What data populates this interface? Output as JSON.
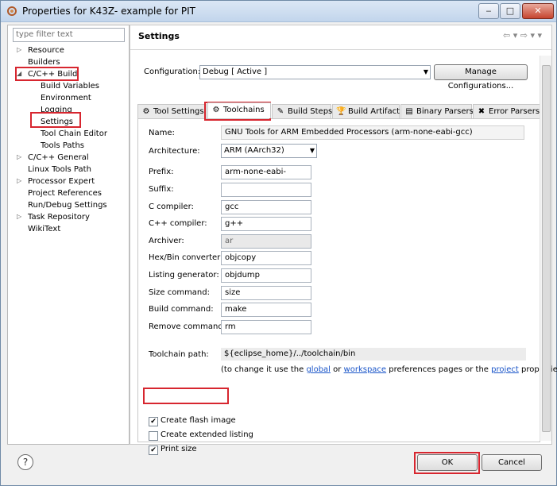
{
  "window": {
    "title": "Properties for K43Z- example for PIT",
    "controls": {
      "minimize": "‒",
      "maximize": "□",
      "close": "✕"
    }
  },
  "left": {
    "filter_placeholder": "type filter text",
    "tree": [
      {
        "label": "Resource",
        "expander": "▷"
      },
      {
        "label": "Builders"
      },
      {
        "label": "C/C++ Build",
        "expander": "◢"
      },
      {
        "label": "Build Variables"
      },
      {
        "label": "Environment"
      },
      {
        "label": "Logging"
      },
      {
        "label": "Settings"
      },
      {
        "label": "Tool Chain Editor"
      },
      {
        "label": "Tools Paths"
      },
      {
        "label": "C/C++ General",
        "expander": "▷"
      },
      {
        "label": "Linux Tools Path"
      },
      {
        "label": "Processor Expert",
        "expander": "▷"
      },
      {
        "label": "Project References"
      },
      {
        "label": "Run/Debug Settings"
      },
      {
        "label": "Task Repository",
        "expander": "▷"
      },
      {
        "label": "WikiText"
      }
    ]
  },
  "right": {
    "title": "Settings",
    "nav": "⇦ ▾ ⇨ ▾ ▾",
    "configuration_label": "Configuration:",
    "configuration_value": "Debug  [ Active ]",
    "manage_button": "Manage Configurations...",
    "tabs": [
      {
        "label": "Tool Settings",
        "icon": "⚙",
        "icon_name": "tool-settings-icon"
      },
      {
        "label": "Toolchains",
        "icon": "⚙",
        "icon_name": "toolchains-icon"
      },
      {
        "label": "Build Steps",
        "icon": "✎",
        "icon_name": "build-steps-icon"
      },
      {
        "label": "Build Artifact",
        "icon": "🏆",
        "icon_name": "build-artifact-icon"
      },
      {
        "label": "Binary Parsers",
        "icon": "▤",
        "icon_name": "binary-parsers-icon"
      },
      {
        "label": "Error Parsers",
        "icon": "✖",
        "icon_name": "error-parsers-icon"
      }
    ],
    "fields": {
      "name": {
        "label": "Name:",
        "value": "GNU Tools for ARM Embedded Processors (arm-none-eabi-gcc)"
      },
      "architecture": {
        "label": "Architecture:",
        "value": "ARM (AArch32)"
      },
      "prefix": {
        "label": "Prefix:",
        "value": "arm-none-eabi-"
      },
      "suffix": {
        "label": "Suffix:",
        "value": ""
      },
      "c_compiler": {
        "label": "C compiler:",
        "value": "gcc"
      },
      "cpp_compiler": {
        "label": "C++ compiler:",
        "value": "g++"
      },
      "archiver": {
        "label": "Archiver:",
        "value": "ar"
      },
      "hexbin": {
        "label": "Hex/Bin converter:",
        "value": "objcopy"
      },
      "listing": {
        "label": "Listing generator:",
        "value": "objdump"
      },
      "size": {
        "label": "Size command:",
        "value": "size"
      },
      "build": {
        "label": "Build command:",
        "value": "make"
      },
      "remove": {
        "label": "Remove command:",
        "value": "rm"
      }
    },
    "toolchain_path_label": "Toolchain path:",
    "toolchain_path_value": "${eclipse_home}/../toolchain/bin",
    "note": {
      "prefix": "(to change it use the ",
      "global": "global",
      "or": " or ",
      "workspace": "workspace",
      "middle": " preferences pages or the ",
      "project": "project",
      "suffix": " properties pa"
    },
    "checkboxes": [
      {
        "label": "Create flash image",
        "checked": true
      },
      {
        "label": "Create extended listing",
        "checked": false
      },
      {
        "label": "Print size",
        "checked": true
      }
    ]
  },
  "footer": {
    "help": "?",
    "ok": "OK",
    "cancel": "Cancel"
  }
}
